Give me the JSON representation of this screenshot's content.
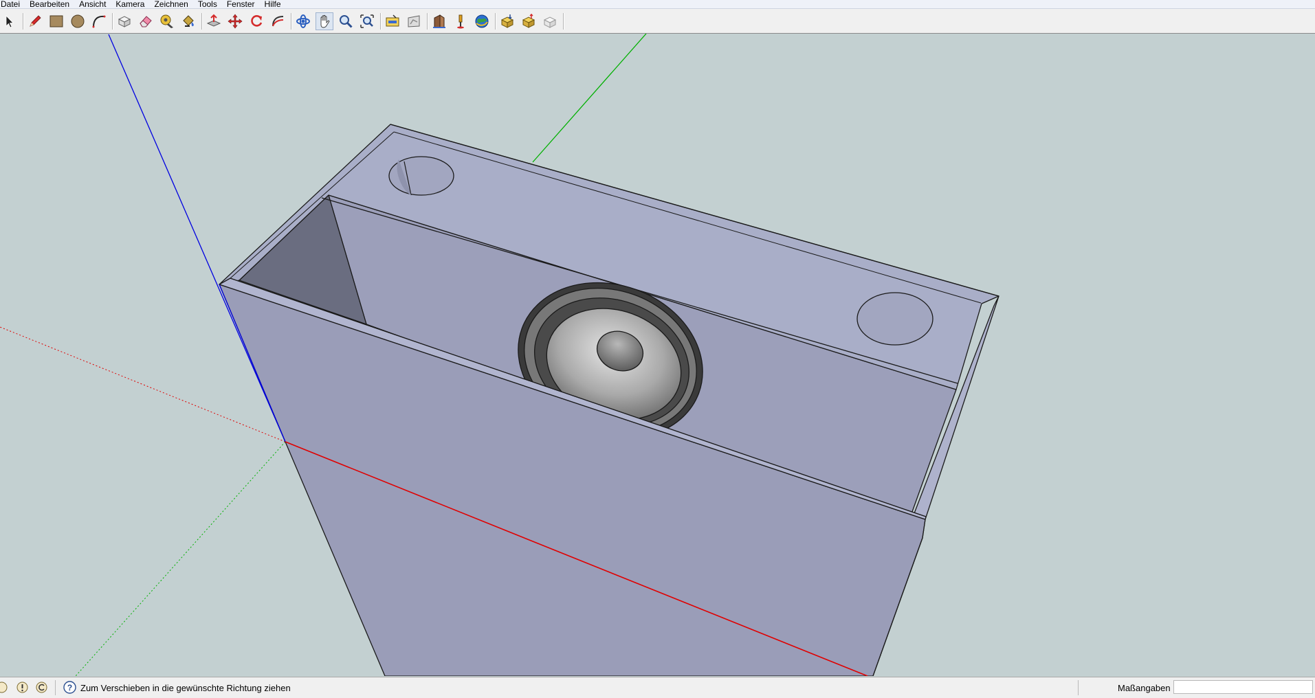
{
  "menu": [
    {
      "id": "file",
      "label": "Datei"
    },
    {
      "id": "edit",
      "label": "Bearbeiten"
    },
    {
      "id": "view",
      "label": "Ansicht"
    },
    {
      "id": "camera",
      "label": "Kamera"
    },
    {
      "id": "draw",
      "label": "Zeichnen"
    },
    {
      "id": "tools",
      "label": "Tools"
    },
    {
      "id": "window",
      "label": "Fenster"
    },
    {
      "id": "help",
      "label": "Hilfe"
    }
  ],
  "toolbar": {
    "tools": [
      "select",
      "pencil",
      "rectangle",
      "circle",
      "arc",
      "make-component",
      "eraser",
      "tape-measure",
      "paint-bucket",
      "push-pull",
      "move",
      "rotate",
      "follow-me",
      "orbit",
      "pan",
      "zoom",
      "zoom-extents",
      "get-models",
      "share-model",
      "share-component",
      "photo-textures",
      "google-earth",
      "preview-earth",
      "toggle-terrain",
      "component-3d"
    ],
    "active_tool": "pan"
  },
  "statusbar": {
    "message": "Zum Verschieben in die gewünschte Richtung ziehen",
    "measure_label": "Maßangaben",
    "measure_value": ""
  },
  "colors": {
    "viewport_bg": "#c3d0d1",
    "face_light": "#a9aec8",
    "face_mid": "#9ca0b8",
    "face_dark": "#6b6f80",
    "axis_red": "#e00000",
    "axis_green": "#00b000",
    "axis_blue": "#0000e0"
  }
}
